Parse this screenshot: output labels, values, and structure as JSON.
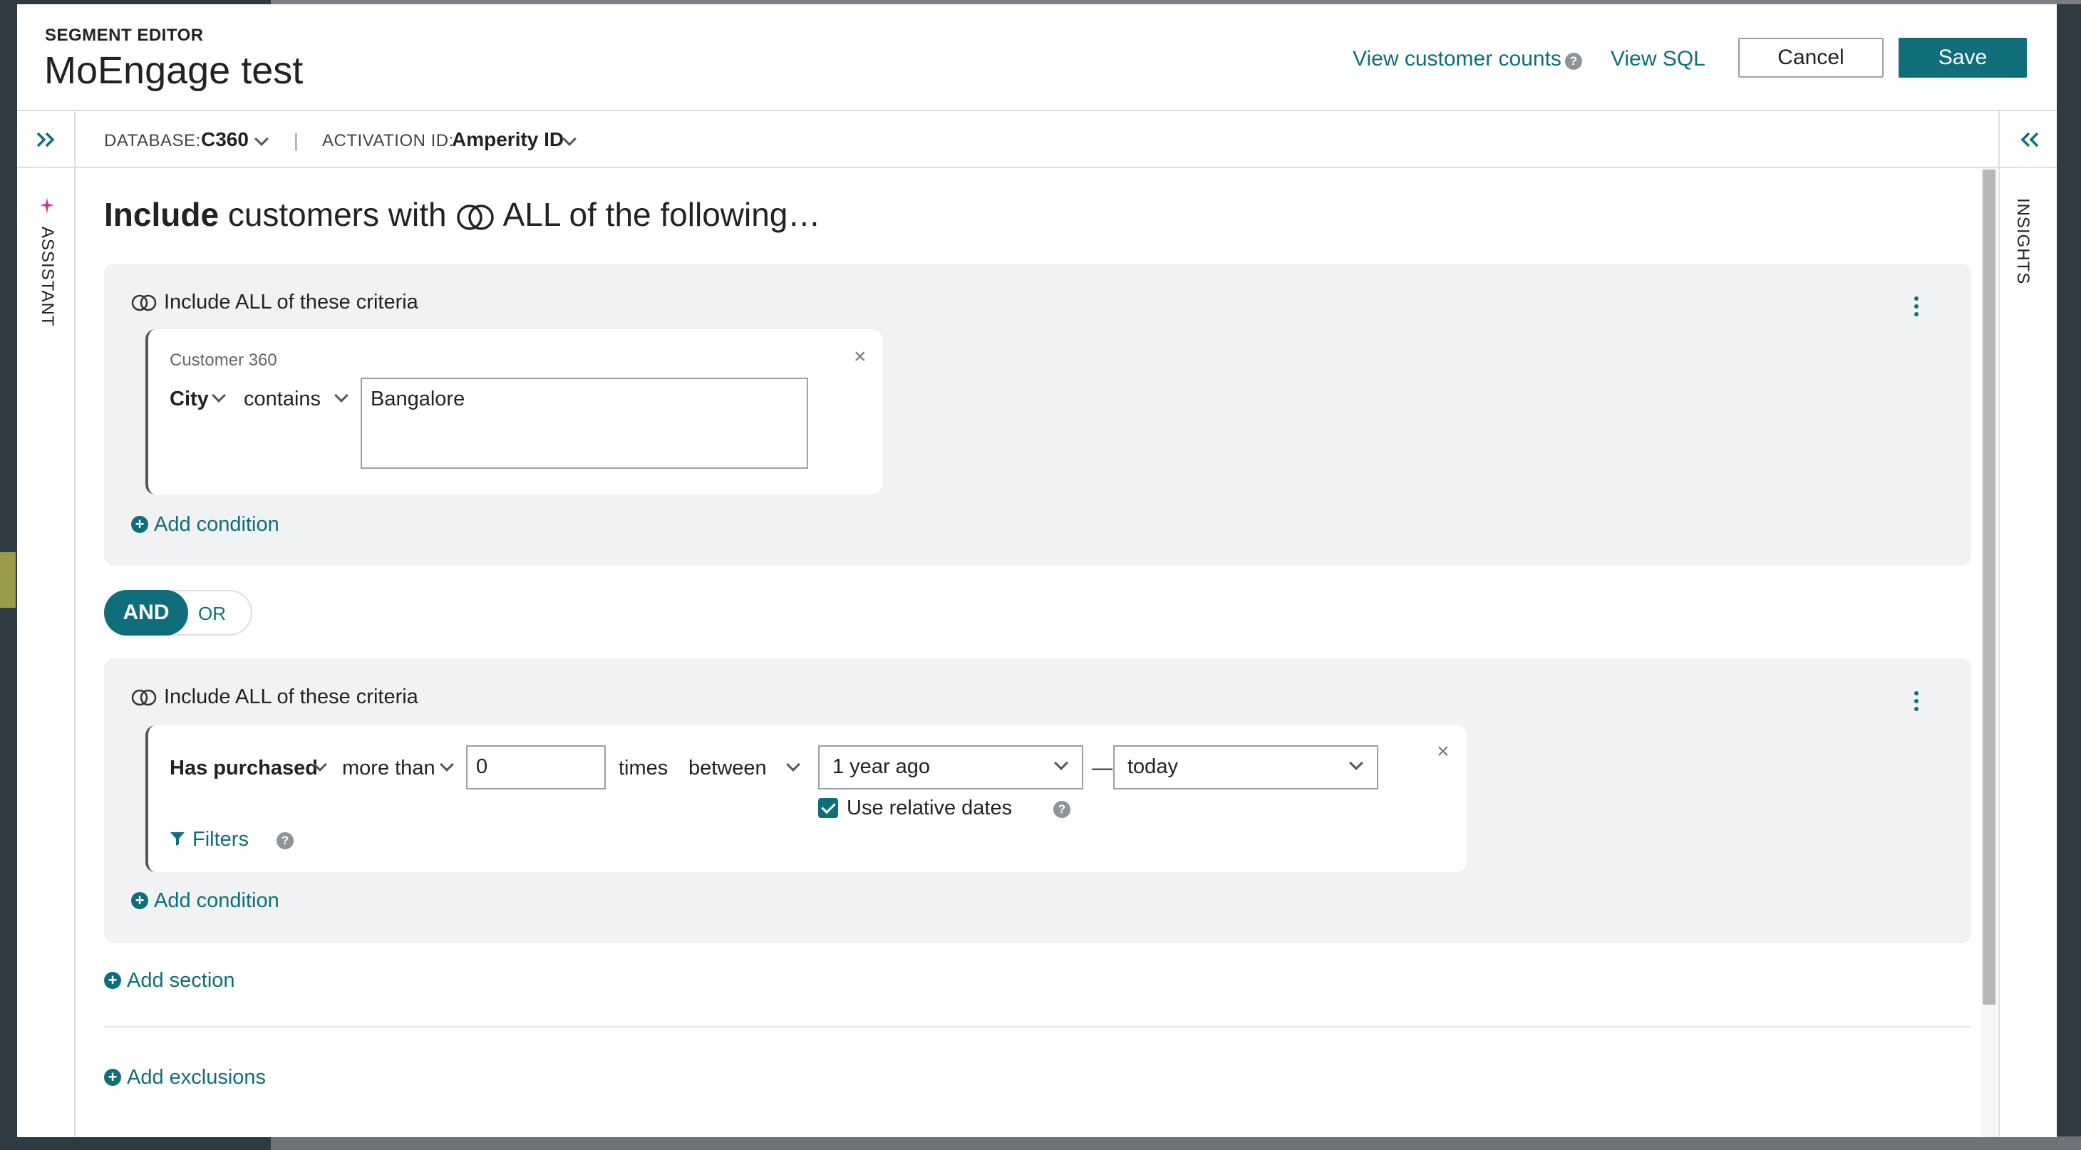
{
  "header": {
    "eyebrow": "SEGMENT EDITOR",
    "title": "MoEngage test",
    "view_counts": "View customer counts",
    "view_sql": "View SQL",
    "cancel": "Cancel",
    "save": "Save",
    "help_glyph": "?"
  },
  "subbar": {
    "database_label": "DATABASE:",
    "database_value": "C360",
    "separator": "|",
    "activation_label": "ACTIVATION ID:",
    "activation_value": "Amperity ID"
  },
  "rails": {
    "assistant": "ASSISTANT",
    "insights": "INSIGHTS"
  },
  "main": {
    "include_word": "Include",
    "include_rest_1": "customers with",
    "include_rest_2": "ALL of the following…",
    "section1": {
      "title": "Include ALL of these criteria",
      "criteria": {
        "source": "Customer 360",
        "field": "City",
        "operator": "contains",
        "value": "Bangalore"
      },
      "add_condition": "Add condition"
    },
    "toggle": {
      "and": "AND",
      "or": "OR"
    },
    "section2": {
      "title": "Include ALL of these criteria",
      "criteria": {
        "field": "Has purchased",
        "operator": "more than",
        "count": "0",
        "times": "times",
        "between": "between",
        "from": "1 year ago",
        "dash": "—",
        "to": "today",
        "relative_dates": "Use relative dates",
        "relative_checked": true,
        "filters": "Filters"
      },
      "add_condition": "Add condition"
    },
    "add_section": "Add section",
    "add_exclusions": "Add exclusions"
  },
  "colors": {
    "accent": "#0f6e7a",
    "assistant_sparkle": "#c43e8f"
  }
}
